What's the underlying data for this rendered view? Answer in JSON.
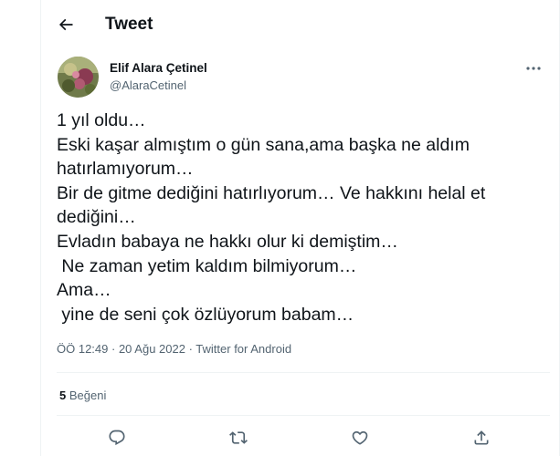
{
  "header": {
    "title": "Tweet",
    "back_icon": "arrow-left-icon"
  },
  "author": {
    "name": "Elif Alara Çetinel",
    "handle": "@AlaraCetinel",
    "avatar": "avatar-photo"
  },
  "tweet": {
    "lines": [
      "1 yıl oldu…",
      "Eski kaşar almıştım o gün sana,ama başka ne aldım",
      "hatırlamıyorum…",
      "Bir de gitme dediğini hatırlıyorum… Ve hakkını helal et",
      "dediğini…",
      "Evladın babaya ne hakkı olur ki demiştim…",
      " Ne zaman yetim kaldım bilmiyorum…",
      "Ama…",
      " yine de seni çok özlüyorum babam…"
    ]
  },
  "meta": {
    "time": "ÖÖ 12:49",
    "separator": " · ",
    "date": "20 Ağu 2022",
    "source": "Twitter for Android"
  },
  "stats": {
    "likes_count": "5",
    "likes_label": "Beğeni"
  },
  "actions": [
    "reply-icon",
    "retweet-icon",
    "like-icon",
    "share-icon"
  ],
  "colors": {
    "text": "#0f1419",
    "secondary": "#536471",
    "border": "#eff3f4"
  }
}
